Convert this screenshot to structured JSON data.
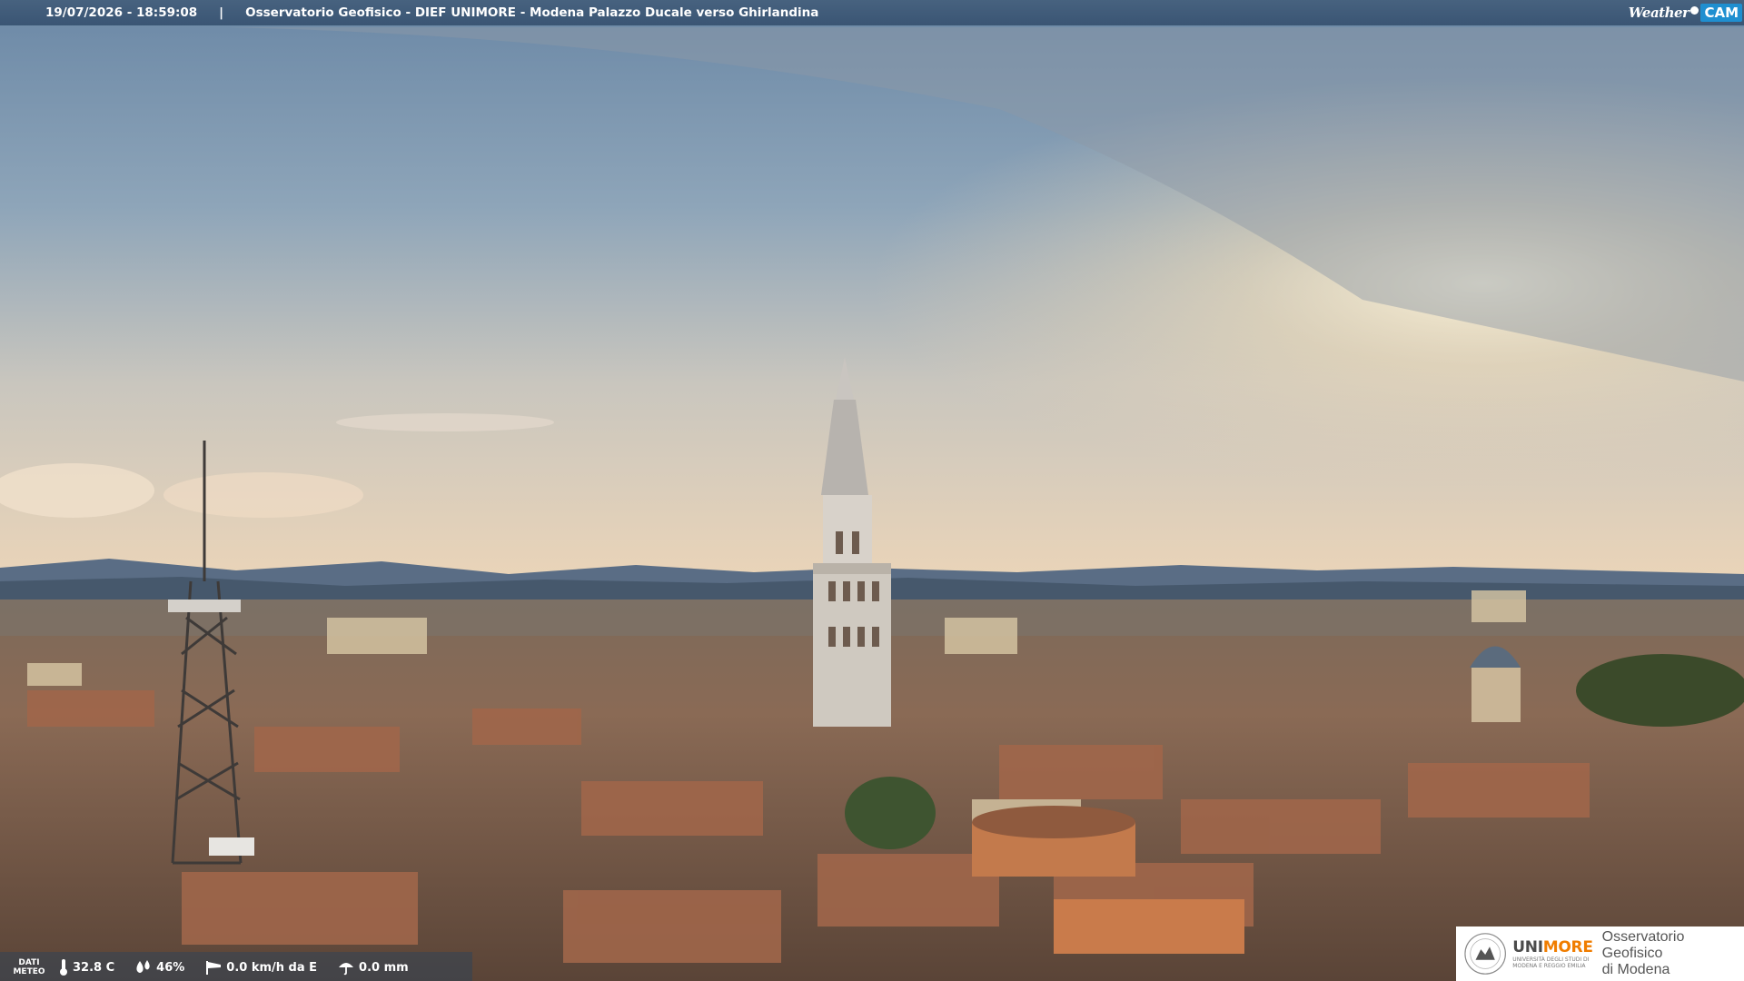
{
  "header": {
    "timestamp": "19/07/2026 - 18:59:08",
    "separator": "|",
    "title": "Osservatorio Geofisico - DIEF UNIMORE - Modena Palazzo Ducale verso Ghirlandina",
    "logo_weather": "Weather",
    "logo_cam": "CAM"
  },
  "weather": {
    "dati_line1": "DATI",
    "dati_line2": "METEO",
    "temperature": "32.8 C",
    "humidity": "46%",
    "wind": "0.0 km/h da E",
    "rain": "0.0 mm",
    "icons": [
      "thermometer-icon",
      "humidity-drops-icon",
      "wind-sock-icon",
      "umbrella-icon"
    ]
  },
  "logo": {
    "brand_uni": "UNI",
    "brand_more": "MORE",
    "brand_sub_line1": "UNIVERSITÀ DEGLI STUDI DI",
    "brand_sub_line2": "MODENA E REGGIO EMILIA",
    "observatory_line1": "Osservatorio Geofisico",
    "observatory_line2": "di Modena"
  },
  "colors": {
    "topbar": "#3f5a78",
    "logo_accent": "#f07d00",
    "cam_blue": "#1f8fd0"
  }
}
